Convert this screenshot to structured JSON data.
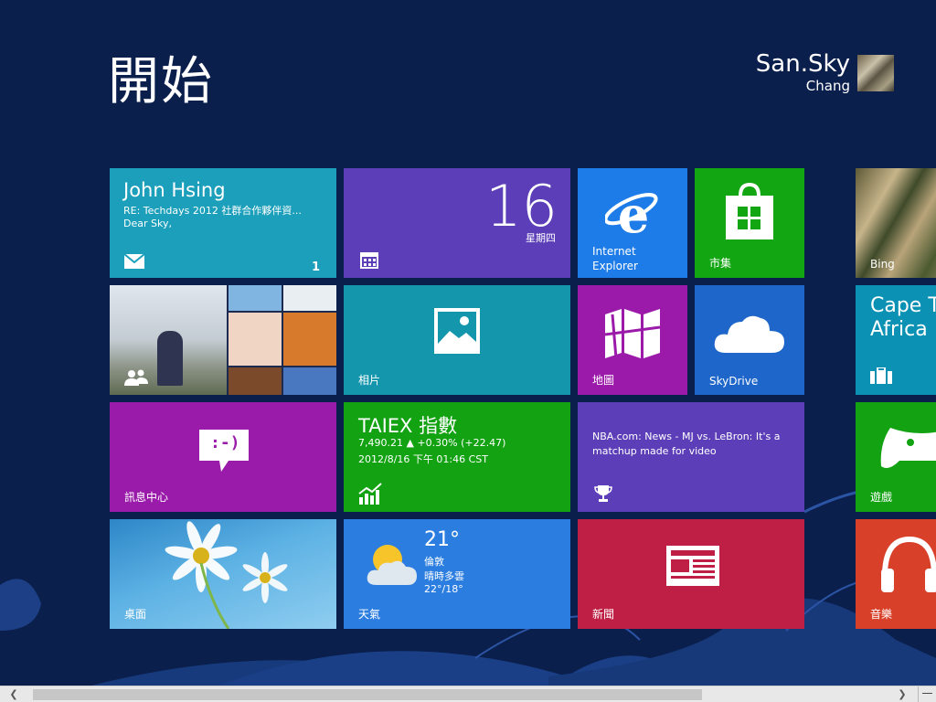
{
  "screen": {
    "title": "開始"
  },
  "user": {
    "first_name": "San.Sky",
    "last_name": "Chang"
  },
  "tiles": {
    "mail": {
      "sender": "John Hsing",
      "subject": "RE: Techdays 2012 社群合作夥伴資...",
      "preview": "Dear Sky,",
      "count": "1",
      "color": "#1b9fba"
    },
    "calendar": {
      "day": "16",
      "weekday": "星期四",
      "color": "#5c3fb8"
    },
    "ie": {
      "label_line1": "Internet",
      "label_line2": "Explorer",
      "color": "#1e7ce8"
    },
    "store": {
      "label": "市集",
      "color": "#12a612"
    },
    "bing": {
      "label": "Bing"
    },
    "people": {
      "label": ""
    },
    "photos": {
      "label": "相片",
      "color": "#1496ad"
    },
    "maps": {
      "label": "地圖",
      "color": "#9b1aa9"
    },
    "skydrive": {
      "label": "SkyDrive",
      "color": "#1e66c9"
    },
    "travel": {
      "place": "Cape T\nAfrica",
      "color": "#0b91b3"
    },
    "messaging": {
      "label": "訊息中心",
      "emoticon": ":-)",
      "color": "#9a1aa9"
    },
    "finance": {
      "title": "TAIEX 指數",
      "quote": "7,490.21  ▲ +0.30% (+22.47)",
      "time": "2012/8/16 下午 01:46 CST",
      "color": "#12a212"
    },
    "sports": {
      "headline": "NBA.com: News -  MJ vs. LeBron: It's a matchup made for video",
      "color": "#5c3fb8"
    },
    "games": {
      "label": "遊戲",
      "color": "#12a212"
    },
    "desktop": {
      "label": "桌面"
    },
    "weather": {
      "temp": "21°",
      "city": "倫敦",
      "condition": "晴時多雲",
      "range": "22°/18°",
      "label": "天氣",
      "color": "#2b7de0"
    },
    "news": {
      "label": "新聞",
      "color": "#c01f45"
    },
    "music": {
      "label": "音樂",
      "color": "#d9402a"
    }
  },
  "icons": {
    "mail": "mail-icon",
    "calendar": "calendar-icon",
    "ie": "internet-explorer-icon",
    "store": "store-icon",
    "people": "people-icon",
    "photos": "photo-icon",
    "maps": "map-icon",
    "skydrive": "cloud-icon",
    "travel": "suitcase-icon",
    "messaging": "chat-bubble-icon",
    "finance": "chart-icon",
    "sports": "trophy-icon",
    "games": "gamepad-icon",
    "weather": "sun-cloud-icon",
    "news": "newspaper-icon",
    "music": "headphones-icon"
  },
  "background_color": "#0b1f4d"
}
